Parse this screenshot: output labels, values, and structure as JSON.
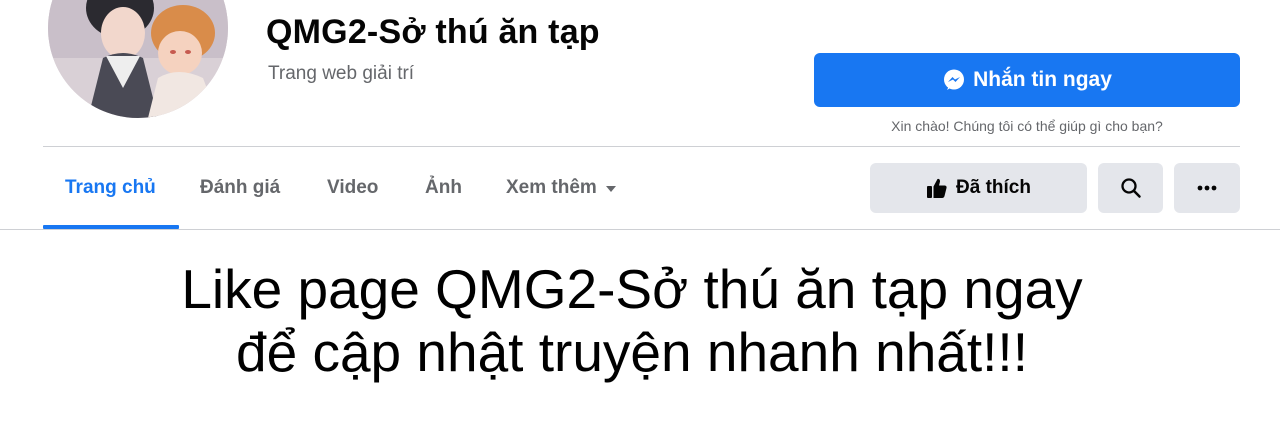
{
  "page": {
    "title": "QMG2-Sở thú ăn tạp",
    "subtitle": "Trang web giải trí"
  },
  "message": {
    "button_label": "Nhắn tin ngay",
    "icon": "messenger-icon",
    "greeting": "Xin chào! Chúng tôi có thể giúp gì cho bạn?"
  },
  "tabs": [
    {
      "label": "Trang chủ",
      "active": true
    },
    {
      "label": "Đánh giá",
      "active": false
    },
    {
      "label": "Video",
      "active": false
    },
    {
      "label": "Ảnh",
      "active": false
    },
    {
      "label": "Xem thêm",
      "active": false
    }
  ],
  "actions": {
    "liked_label": "Đã thích",
    "liked_icon": "thumbs-up-icon",
    "search_icon": "search-icon",
    "more_icon": "more-dots-icon"
  },
  "promo": {
    "line1": "Like page QMG2-Sở thú ăn tạp ngay",
    "line2": "để cập nhật truyện nhanh nhất!!!"
  },
  "colors": {
    "accent": "#1877f2",
    "secondary_button": "#e4e6eb",
    "muted_text": "#65676b"
  }
}
